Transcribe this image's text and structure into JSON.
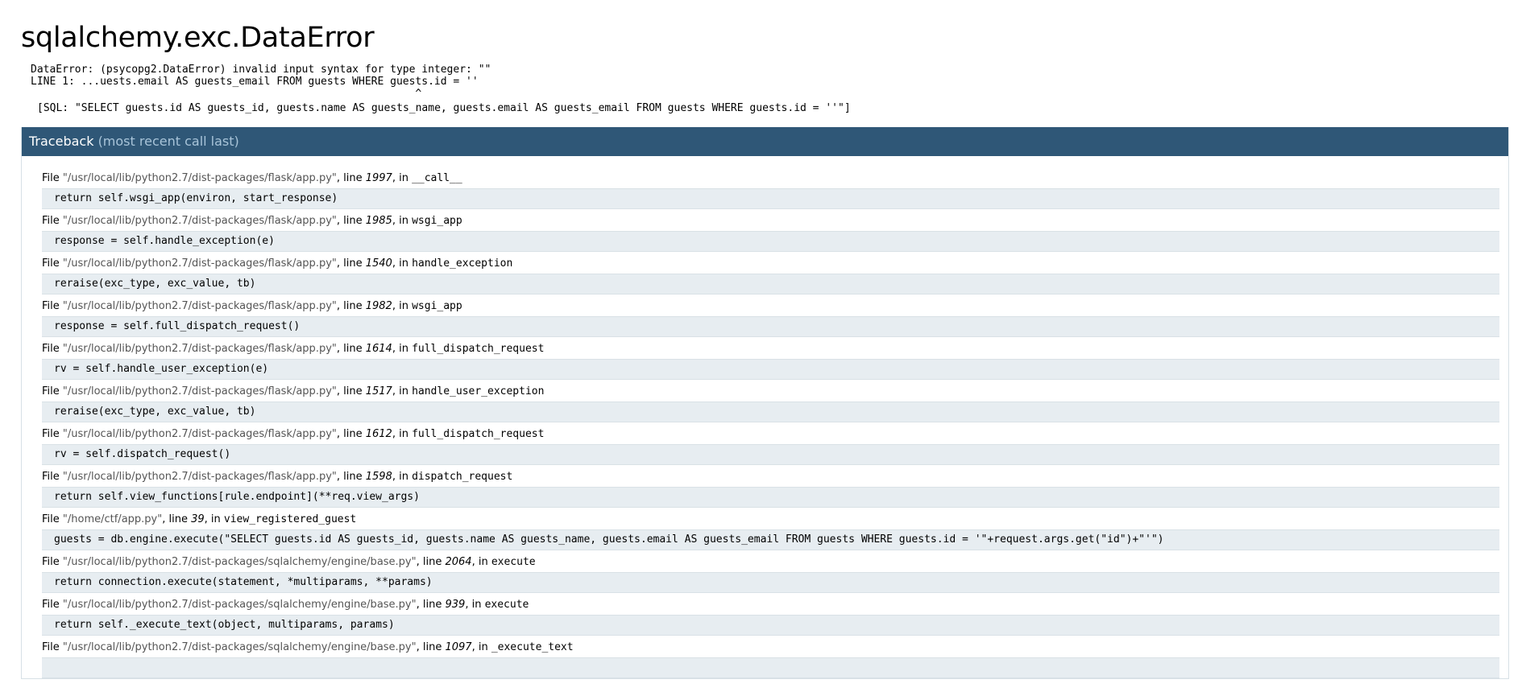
{
  "error": {
    "title": "sqlalchemy.exc.DataError",
    "message": "DataError: (psycopg2.DataError) invalid input syntax for type integer: \"\"\nLINE 1: ...uests.email AS guests_email FROM guests WHERE guests.id = ''\n                                                             ^",
    "sql": "[SQL: \"SELECT guests.id AS guests_id, guests.name AS guests_name, guests.email AS guests_email FROM guests WHERE guests.id = ''\"]"
  },
  "traceback": {
    "title": "Traceback",
    "subtitle": "(most recent call last)",
    "frames": [
      {
        "file": "/usr/local/lib/python2.7/dist-packages/flask/app.py",
        "line": "1997",
        "function": "__call__",
        "code": "return self.wsgi_app(environ, start_response)"
      },
      {
        "file": "/usr/local/lib/python2.7/dist-packages/flask/app.py",
        "line": "1985",
        "function": "wsgi_app",
        "code": "response = self.handle_exception(e)"
      },
      {
        "file": "/usr/local/lib/python2.7/dist-packages/flask/app.py",
        "line": "1540",
        "function": "handle_exception",
        "code": "reraise(exc_type, exc_value, tb)"
      },
      {
        "file": "/usr/local/lib/python2.7/dist-packages/flask/app.py",
        "line": "1982",
        "function": "wsgi_app",
        "code": "response = self.full_dispatch_request()"
      },
      {
        "file": "/usr/local/lib/python2.7/dist-packages/flask/app.py",
        "line": "1614",
        "function": "full_dispatch_request",
        "code": "rv = self.handle_user_exception(e)"
      },
      {
        "file": "/usr/local/lib/python2.7/dist-packages/flask/app.py",
        "line": "1517",
        "function": "handle_user_exception",
        "code": "reraise(exc_type, exc_value, tb)"
      },
      {
        "file": "/usr/local/lib/python2.7/dist-packages/flask/app.py",
        "line": "1612",
        "function": "full_dispatch_request",
        "code": "rv = self.dispatch_request()"
      },
      {
        "file": "/usr/local/lib/python2.7/dist-packages/flask/app.py",
        "line": "1598",
        "function": "dispatch_request",
        "code": "return self.view_functions[rule.endpoint](**req.view_args)"
      },
      {
        "file": "/home/ctf/app.py",
        "line": "39",
        "function": "view_registered_guest",
        "code": "guests = db.engine.execute(\"SELECT guests.id AS guests_id, guests.name AS guests_name, guests.email AS guests_email FROM guests WHERE guests.id = '\"+request.args.get(\"id\")+\"'\")"
      },
      {
        "file": "/usr/local/lib/python2.7/dist-packages/sqlalchemy/engine/base.py",
        "line": "2064",
        "function": "execute",
        "code": "return connection.execute(statement, *multiparams, **params)"
      },
      {
        "file": "/usr/local/lib/python2.7/dist-packages/sqlalchemy/engine/base.py",
        "line": "939",
        "function": "execute",
        "code": "return self._execute_text(object, multiparams, params)"
      },
      {
        "file": "/usr/local/lib/python2.7/dist-packages/sqlalchemy/engine/base.py",
        "line": "1097",
        "function": "_execute_text",
        "code": ""
      }
    ]
  }
}
